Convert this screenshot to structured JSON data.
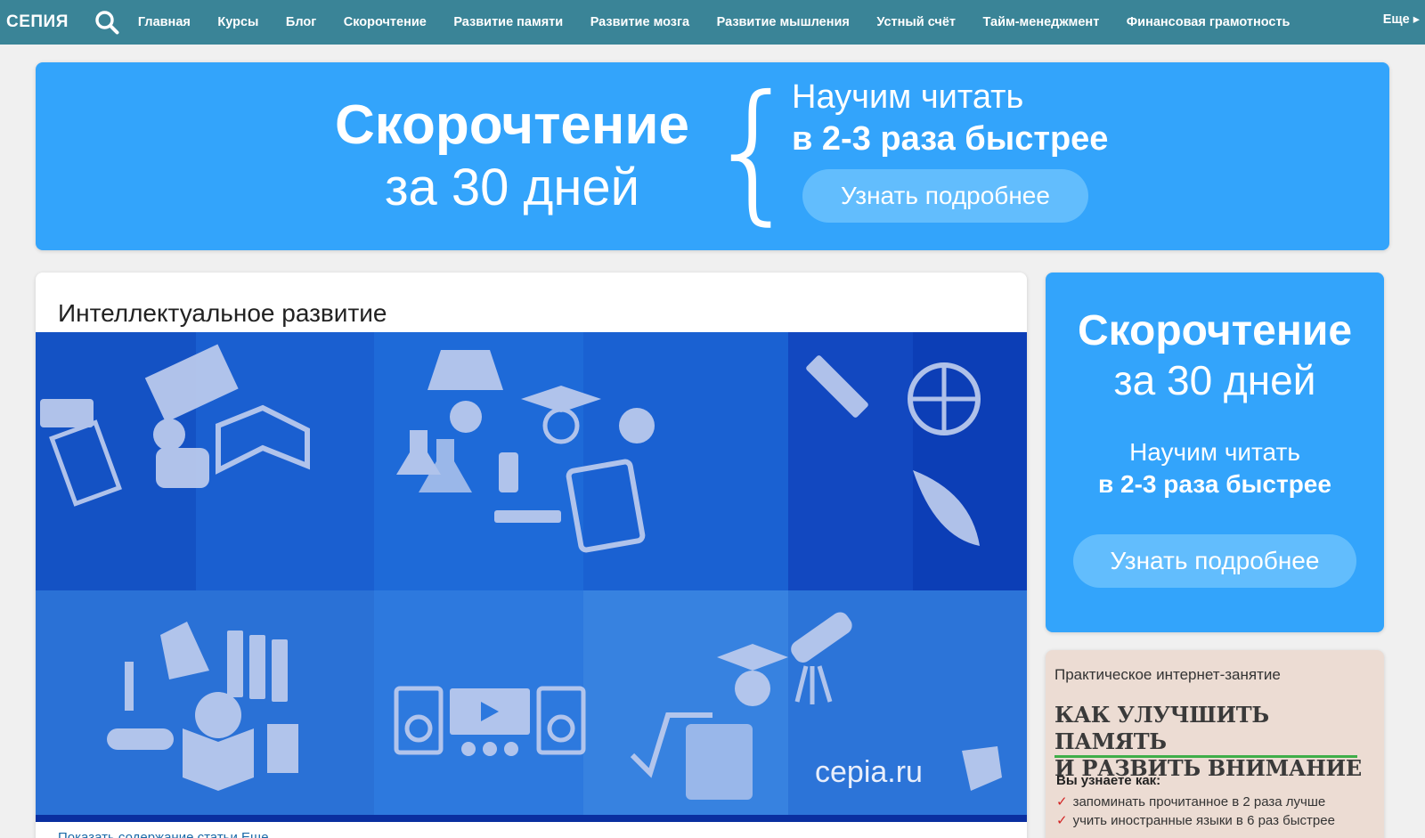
{
  "nav": {
    "logo": "СЕПИЯ",
    "search_icon": "search-icon",
    "links": [
      "Главная",
      "Курсы",
      "Блог",
      "Скорочтение",
      "Развитие памяти",
      "Развитие мозга",
      "Развитие мышления",
      "Устный счёт",
      "Тайм-менеджмент",
      "Финансовая грамотность"
    ],
    "more": "Еще ▸"
  },
  "banner": {
    "title_line1": "Скорочтение",
    "title_line2": "за 30 дней",
    "brace": "{",
    "sub_line1": "Научим читать",
    "sub_line2": "в 2-3 раза быстрее",
    "button": "Узнать подробнее",
    "bg_color": "#33a4fb"
  },
  "article": {
    "title": "Интеллектуальное развитие",
    "image_watermark": "cepia.ru",
    "link_text": "Показать содержание статьи Еще"
  },
  "sidebar_ad": {
    "title_line1": "Скорочтение",
    "title_line2": "за 30 дней",
    "sub_line1": "Научим читать",
    "sub_line2": "в 2-3 раза быстрее",
    "button": "Узнать подробнее"
  },
  "promo": {
    "kicker": "Практическое интернет-занятие",
    "headline_line1": "КАК УЛУЧШИТЬ ПАМЯТЬ",
    "headline_line2": "И РАЗВИТЬ ВНИМАНИЕ",
    "learn_label": "Вы узнаете как:",
    "bullets": [
      "запоминать прочитанное в 2 раза лучше",
      "учить иностранные языки в 6 раз быстрее"
    ],
    "accent_color": "#3fae49"
  }
}
